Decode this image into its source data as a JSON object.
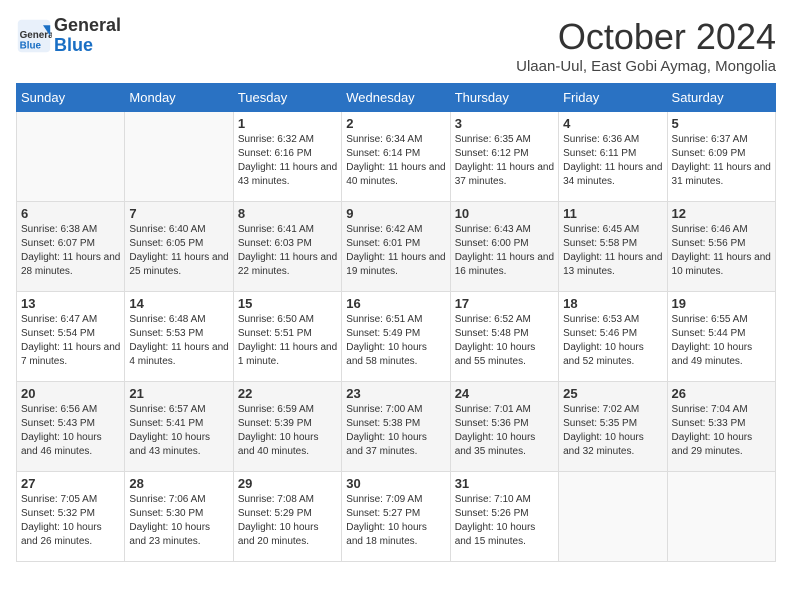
{
  "header": {
    "logo_general": "General",
    "logo_blue": "Blue",
    "month_title": "October 2024",
    "subtitle": "Ulaan-Uul, East Gobi Aymag, Mongolia"
  },
  "days_of_week": [
    "Sunday",
    "Monday",
    "Tuesday",
    "Wednesday",
    "Thursday",
    "Friday",
    "Saturday"
  ],
  "weeks": [
    [
      {
        "day": "",
        "info": ""
      },
      {
        "day": "",
        "info": ""
      },
      {
        "day": "1",
        "info": "Sunrise: 6:32 AM\nSunset: 6:16 PM\nDaylight: 11 hours and 43 minutes."
      },
      {
        "day": "2",
        "info": "Sunrise: 6:34 AM\nSunset: 6:14 PM\nDaylight: 11 hours and 40 minutes."
      },
      {
        "day": "3",
        "info": "Sunrise: 6:35 AM\nSunset: 6:12 PM\nDaylight: 11 hours and 37 minutes."
      },
      {
        "day": "4",
        "info": "Sunrise: 6:36 AM\nSunset: 6:11 PM\nDaylight: 11 hours and 34 minutes."
      },
      {
        "day": "5",
        "info": "Sunrise: 6:37 AM\nSunset: 6:09 PM\nDaylight: 11 hours and 31 minutes."
      }
    ],
    [
      {
        "day": "6",
        "info": "Sunrise: 6:38 AM\nSunset: 6:07 PM\nDaylight: 11 hours and 28 minutes."
      },
      {
        "day": "7",
        "info": "Sunrise: 6:40 AM\nSunset: 6:05 PM\nDaylight: 11 hours and 25 minutes."
      },
      {
        "day": "8",
        "info": "Sunrise: 6:41 AM\nSunset: 6:03 PM\nDaylight: 11 hours and 22 minutes."
      },
      {
        "day": "9",
        "info": "Sunrise: 6:42 AM\nSunset: 6:01 PM\nDaylight: 11 hours and 19 minutes."
      },
      {
        "day": "10",
        "info": "Sunrise: 6:43 AM\nSunset: 6:00 PM\nDaylight: 11 hours and 16 minutes."
      },
      {
        "day": "11",
        "info": "Sunrise: 6:45 AM\nSunset: 5:58 PM\nDaylight: 11 hours and 13 minutes."
      },
      {
        "day": "12",
        "info": "Sunrise: 6:46 AM\nSunset: 5:56 PM\nDaylight: 11 hours and 10 minutes."
      }
    ],
    [
      {
        "day": "13",
        "info": "Sunrise: 6:47 AM\nSunset: 5:54 PM\nDaylight: 11 hours and 7 minutes."
      },
      {
        "day": "14",
        "info": "Sunrise: 6:48 AM\nSunset: 5:53 PM\nDaylight: 11 hours and 4 minutes."
      },
      {
        "day": "15",
        "info": "Sunrise: 6:50 AM\nSunset: 5:51 PM\nDaylight: 11 hours and 1 minute."
      },
      {
        "day": "16",
        "info": "Sunrise: 6:51 AM\nSunset: 5:49 PM\nDaylight: 10 hours and 58 minutes."
      },
      {
        "day": "17",
        "info": "Sunrise: 6:52 AM\nSunset: 5:48 PM\nDaylight: 10 hours and 55 minutes."
      },
      {
        "day": "18",
        "info": "Sunrise: 6:53 AM\nSunset: 5:46 PM\nDaylight: 10 hours and 52 minutes."
      },
      {
        "day": "19",
        "info": "Sunrise: 6:55 AM\nSunset: 5:44 PM\nDaylight: 10 hours and 49 minutes."
      }
    ],
    [
      {
        "day": "20",
        "info": "Sunrise: 6:56 AM\nSunset: 5:43 PM\nDaylight: 10 hours and 46 minutes."
      },
      {
        "day": "21",
        "info": "Sunrise: 6:57 AM\nSunset: 5:41 PM\nDaylight: 10 hours and 43 minutes."
      },
      {
        "day": "22",
        "info": "Sunrise: 6:59 AM\nSunset: 5:39 PM\nDaylight: 10 hours and 40 minutes."
      },
      {
        "day": "23",
        "info": "Sunrise: 7:00 AM\nSunset: 5:38 PM\nDaylight: 10 hours and 37 minutes."
      },
      {
        "day": "24",
        "info": "Sunrise: 7:01 AM\nSunset: 5:36 PM\nDaylight: 10 hours and 35 minutes."
      },
      {
        "day": "25",
        "info": "Sunrise: 7:02 AM\nSunset: 5:35 PM\nDaylight: 10 hours and 32 minutes."
      },
      {
        "day": "26",
        "info": "Sunrise: 7:04 AM\nSunset: 5:33 PM\nDaylight: 10 hours and 29 minutes."
      }
    ],
    [
      {
        "day": "27",
        "info": "Sunrise: 7:05 AM\nSunset: 5:32 PM\nDaylight: 10 hours and 26 minutes."
      },
      {
        "day": "28",
        "info": "Sunrise: 7:06 AM\nSunset: 5:30 PM\nDaylight: 10 hours and 23 minutes."
      },
      {
        "day": "29",
        "info": "Sunrise: 7:08 AM\nSunset: 5:29 PM\nDaylight: 10 hours and 20 minutes."
      },
      {
        "day": "30",
        "info": "Sunrise: 7:09 AM\nSunset: 5:27 PM\nDaylight: 10 hours and 18 minutes."
      },
      {
        "day": "31",
        "info": "Sunrise: 7:10 AM\nSunset: 5:26 PM\nDaylight: 10 hours and 15 minutes."
      },
      {
        "day": "",
        "info": ""
      },
      {
        "day": "",
        "info": ""
      }
    ]
  ]
}
